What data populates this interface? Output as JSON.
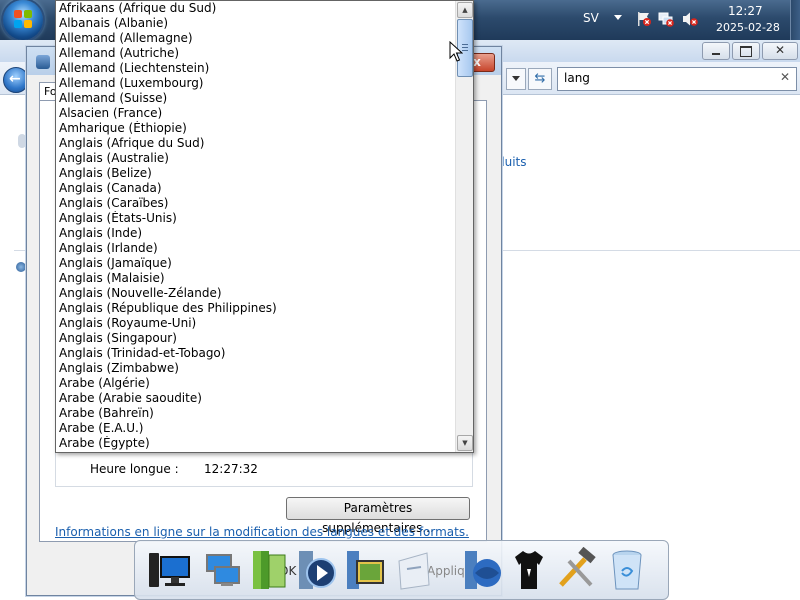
{
  "taskbar": {
    "language": "SV",
    "time": "12:27",
    "date": "2025-02-28"
  },
  "explorer": {
    "search_value": "lang",
    "link_partial": "duits"
  },
  "dialog": {
    "close_glyph": "x",
    "tab_label": "Fo",
    "heure_longue_label": "Heure longue :",
    "heure_longue_value": "12:27:32",
    "params_button": "Paramètres supplémentaires...",
    "info_link": "Informations en ligne sur la modification des langues et des formats."
  },
  "dropdown": {
    "items": [
      "Afrikaans (Afrique du Sud)",
      "Albanais (Albanie)",
      "Allemand (Allemagne)",
      "Allemand (Autriche)",
      "Allemand (Liechtenstein)",
      "Allemand (Luxembourg)",
      "Allemand (Suisse)",
      "Alsacien (France)",
      "Amharique (Éthiopie)",
      "Anglais (Afrique du Sud)",
      "Anglais (Australie)",
      "Anglais (Belize)",
      "Anglais (Canada)",
      "Anglais (Caraïbes)",
      "Anglais (États-Unis)",
      "Anglais (Inde)",
      "Anglais (Irlande)",
      "Anglais (Jamaïque)",
      "Anglais (Malaisie)",
      "Anglais (Nouvelle-Zélande)",
      "Anglais (République des Philippines)",
      "Anglais (Royaume-Uni)",
      "Anglais (Singapour)",
      "Anglais (Trinidad-et-Tobago)",
      "Anglais (Zimbabwe)",
      "Arabe (Algérie)",
      "Arabe (Arabie saoudite)",
      "Arabe (Bahreïn)",
      "Arabe (E.A.U.)",
      "Arabe (Égypte)"
    ]
  },
  "dock": {
    "ok_ghost": "OK",
    "apply_ghost": "Appliquer"
  }
}
